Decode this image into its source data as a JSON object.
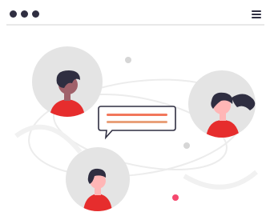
{
  "window": {
    "controls": [
      "window-dot",
      "window-dot",
      "window-dot"
    ],
    "menu_icon": "hamburger-menu-icon"
  },
  "illustration": {
    "users": [
      {
        "name": "user-avatar-top-left",
        "hair": "#2f2e41",
        "skin": "#a0616a",
        "shirt": "#e62d2d"
      },
      {
        "name": "user-avatar-right",
        "hair": "#2f2e41",
        "skin": "#ffb6b6",
        "shirt": "#e62d2d"
      },
      {
        "name": "user-avatar-bottom",
        "hair": "#2f2e41",
        "skin": "#ffb6b6",
        "shirt": "#e62d2d"
      }
    ],
    "chat_bubble": {
      "line_colors": [
        "#f2775b",
        "#e9a07a"
      ]
    },
    "colors": {
      "avatar_bg": "#e4e4e4",
      "orbit": "#ececec",
      "accent": "#f5486e",
      "text_dark": "#2f2e41"
    }
  }
}
